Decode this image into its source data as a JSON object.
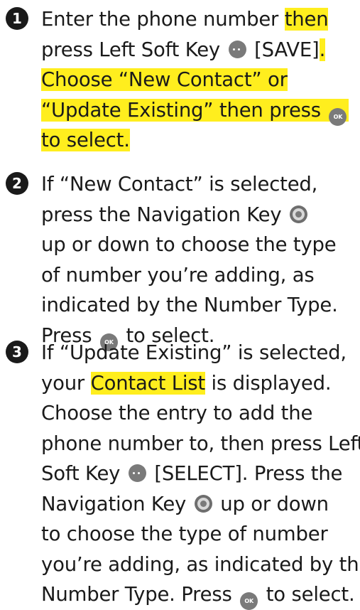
{
  "colors": {
    "highlight": "#ffee1e",
    "text": "#1a1a1a"
  },
  "icons": {
    "soft_key": "soft-key-icon",
    "ok_key": "ok-key-icon",
    "nav_key": "navigation-key-icon"
  },
  "ok_glyph": "OK",
  "steps": [
    {
      "number": "1",
      "l1a": "Enter the phone number ",
      "l1b": "then",
      "l2a": "press Left Soft Key ",
      "l2b": " [SAVE]",
      "l2c": ".",
      "l3": "Choose “New Contact” or",
      "l4": "“Update Existing” then press ",
      "l5": "to select."
    },
    {
      "number": "2",
      "l1": "If “New Contact” is selected,",
      "l2": "press the Navigation Key ",
      "l3": "up or down to choose the type",
      "l4": "of number you’re adding, as",
      "l5": "indicated by the Number Type.",
      "l6a": "Press ",
      "l6b": " to select."
    },
    {
      "number": "3",
      "l1": "If “Update Existing” is selected,",
      "l2a": "your ",
      "l2b": "Contact List",
      "l2c": " is displayed.",
      "l3": "Choose the entry to add the",
      "l4": "phone number to, then press Left",
      "l5a": "Soft Key ",
      "l5b": " [SELECT]. Press the",
      "l6a": "Navigation Key ",
      "l6b": " up or down",
      "l7": "to choose the type of number",
      "l8": "you’re adding, as indicated by the",
      "l9a": "Number Type. Press ",
      "l9b": " to select."
    }
  ]
}
